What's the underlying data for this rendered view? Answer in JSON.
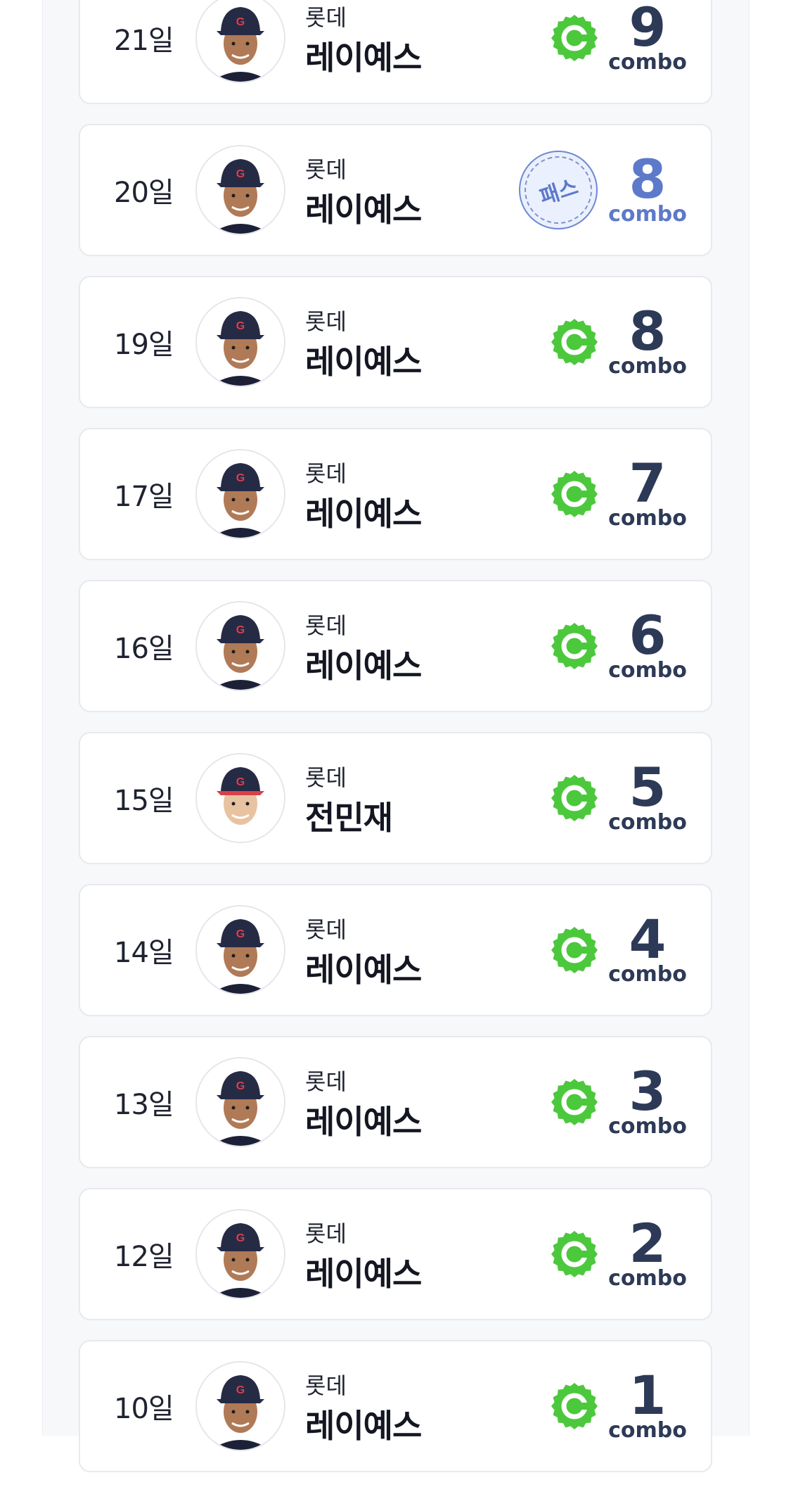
{
  "entries": [
    {
      "day": "21일",
      "team": "롯데",
      "name": "레이예스",
      "badge": "check",
      "combo": "9",
      "combo_label": "combo"
    },
    {
      "day": "20일",
      "team": "롯데",
      "name": "레이예스",
      "badge": "pass",
      "badge_text": "패스",
      "combo": "8",
      "combo_label": "combo"
    },
    {
      "day": "19일",
      "team": "롯데",
      "name": "레이예스",
      "badge": "check",
      "combo": "8",
      "combo_label": "combo"
    },
    {
      "day": "17일",
      "team": "롯데",
      "name": "레이예스",
      "badge": "check",
      "combo": "7",
      "combo_label": "combo"
    },
    {
      "day": "16일",
      "team": "롯데",
      "name": "레이예스",
      "badge": "check",
      "combo": "6",
      "combo_label": "combo"
    },
    {
      "day": "15일",
      "team": "롯데",
      "name": "전민재",
      "badge": "check",
      "combo": "5",
      "combo_label": "combo"
    },
    {
      "day": "14일",
      "team": "롯데",
      "name": "레이예스",
      "badge": "check",
      "combo": "4",
      "combo_label": "combo"
    },
    {
      "day": "13일",
      "team": "롯데",
      "name": "레이예스",
      "badge": "check",
      "combo": "3",
      "combo_label": "combo"
    },
    {
      "day": "12일",
      "team": "롯데",
      "name": "레이예스",
      "badge": "check",
      "combo": "2",
      "combo_label": "combo"
    },
    {
      "day": "10일",
      "team": "롯데",
      "name": "레이예스",
      "badge": "check",
      "combo": "1",
      "combo_label": "combo"
    }
  ],
  "colors": {
    "hit_badge": "#4cc83c",
    "pass_badge": "#5d79c9",
    "combo_text": "#2d3a57",
    "cap": "#262b45",
    "cap_logo": "#d8404a"
  },
  "icons": {
    "hit": "green-c-badge-icon",
    "pass": "pass-stamp-icon",
    "avatar": "player-photo"
  }
}
